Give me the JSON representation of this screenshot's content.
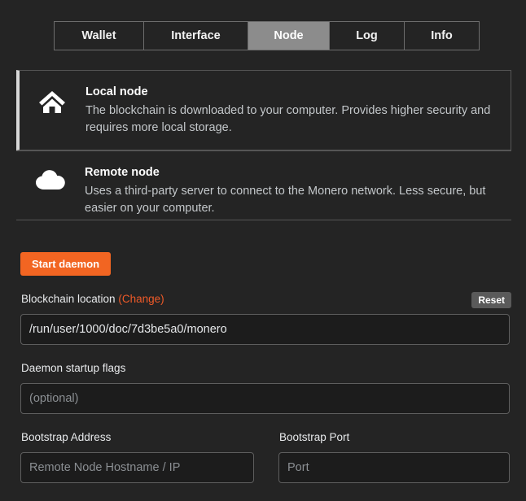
{
  "tabs": [
    {
      "label": "Wallet",
      "name": "tab-wallet",
      "active": false
    },
    {
      "label": "Interface",
      "name": "tab-interface",
      "active": false
    },
    {
      "label": "Node",
      "name": "tab-node",
      "active": true
    },
    {
      "label": "Log",
      "name": "tab-log",
      "active": false
    },
    {
      "label": "Info",
      "name": "tab-info",
      "active": false
    }
  ],
  "node_options": {
    "local": {
      "icon": "home-icon",
      "title": "Local node",
      "description": "The blockchain is downloaded to your computer. Provides higher security and requires more local storage.",
      "selected": true
    },
    "remote": {
      "icon": "cloud-icon",
      "title": "Remote node",
      "description": "Uses a third-party server to connect to the Monero network. Less secure, but easier on your computer.",
      "selected": false
    }
  },
  "actions": {
    "start_daemon_label": "Start daemon",
    "reset_label": "Reset"
  },
  "fields": {
    "blockchain_location": {
      "label": "Blockchain location",
      "change_link": "(Change)",
      "value": "/run/user/1000/doc/7d3be5a0/monero",
      "placeholder": ""
    },
    "daemon_startup_flags": {
      "label": "Daemon startup flags",
      "value": "",
      "placeholder": "(optional)"
    },
    "bootstrap_address": {
      "label": "Bootstrap Address",
      "value": "",
      "placeholder": "Remote Node Hostname / IP"
    },
    "bootstrap_port": {
      "label": "Bootstrap Port",
      "value": "",
      "placeholder": "Port"
    }
  },
  "colors": {
    "background": "#242424",
    "accent_orange": "#f26522",
    "link_orange": "#f05a28",
    "active_tab": "#8c8c8c",
    "border": "#5e5e5e",
    "input_bg": "#1c1c1c"
  }
}
